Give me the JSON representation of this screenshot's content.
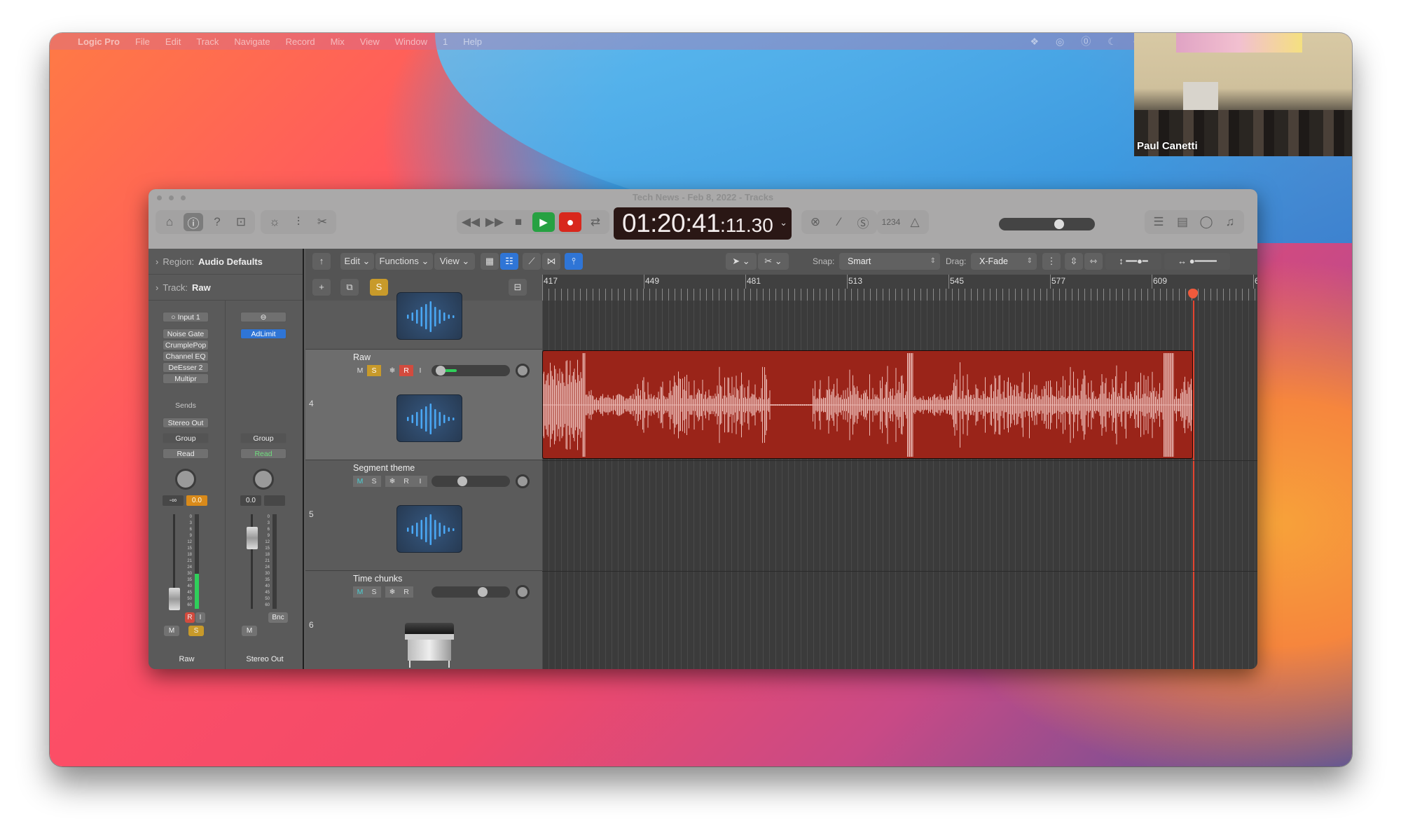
{
  "menubar": {
    "app": "Logic Pro",
    "items": [
      "File",
      "Edit",
      "Track",
      "Navigate",
      "Record",
      "Mix",
      "View",
      "Window",
      "1",
      "Help"
    ],
    "status_icons": [
      "dropbox-icon",
      "creative-cloud-icon",
      "onepassword-icon",
      "moon-icon",
      "wifi-icon"
    ]
  },
  "video": {
    "name": "Paul Canetti"
  },
  "window": {
    "title": "Tech News - Feb 8, 2022 - Tracks",
    "lcd": {
      "main": "01:20:41",
      "sub": ":11.30"
    },
    "count_in": "1234",
    "master_volume": 0.65
  },
  "inspector": {
    "region_label": "Region:",
    "region_value": "Audio Defaults",
    "track_label": "Track:",
    "track_value": "Raw",
    "strip_a": {
      "input": "Input 1",
      "plugins": [
        "Noise Gate",
        "CrumplePop",
        "Channel EQ",
        "DeEsser 2",
        "Multipr"
      ],
      "sends": "Sends",
      "output": "Stereo Out",
      "group": "Group",
      "automation": "Read",
      "pan_value": "-∞",
      "gain_value": "0.0",
      "meter_level": 0.37,
      "buttons": {
        "r": "R",
        "i": "I",
        "m": "M",
        "s": "S"
      },
      "name": "Raw"
    },
    "strip_b": {
      "plugins": [
        "AdLimit"
      ],
      "group": "Group",
      "automation": "Read",
      "pan_value": "0.0",
      "bounce": "Bnc",
      "buttons": {
        "m": "M"
      },
      "name": "Stereo Out"
    },
    "meter_scale": [
      "0",
      "3",
      "6",
      "9",
      "12",
      "15",
      "18",
      "21",
      "24",
      "30",
      "35",
      "40",
      "45",
      "50",
      "60"
    ]
  },
  "toolbar": {
    "edit": "Edit",
    "functions": "Functions",
    "view": "View",
    "snap_label": "Snap:",
    "snap_value": "Smart",
    "drag_label": "Drag:",
    "drag_value": "X-Fade"
  },
  "ruler": {
    "bars": [
      "417",
      "449",
      "481",
      "513",
      "545",
      "577",
      "609",
      "6"
    ],
    "playhead_bar": 622
  },
  "tracks": [
    {
      "num": "4",
      "name": "Raw",
      "buttons": [
        "M",
        "S",
        "❄",
        "R",
        "I"
      ],
      "volume": 0.05,
      "selected": true,
      "icon": "audio-waveform"
    },
    {
      "num": "5",
      "name": "Segment theme",
      "buttons": [
        "M",
        "S",
        "❄",
        "R",
        "I"
      ],
      "volume": 0.38,
      "selected": false,
      "icon": "audio-waveform"
    },
    {
      "num": "6",
      "name": "Time chunks",
      "buttons": [
        "M",
        "S",
        "❄",
        "R"
      ],
      "volume": 0.68,
      "selected": false,
      "icon": "electric-piano"
    }
  ],
  "colors": {
    "region": "#9a2419",
    "playhead": "#e5442f",
    "play": "#26a142",
    "record": "#d8271c",
    "solo": "#c89a2a",
    "selected_blue": "#2f75d6"
  }
}
